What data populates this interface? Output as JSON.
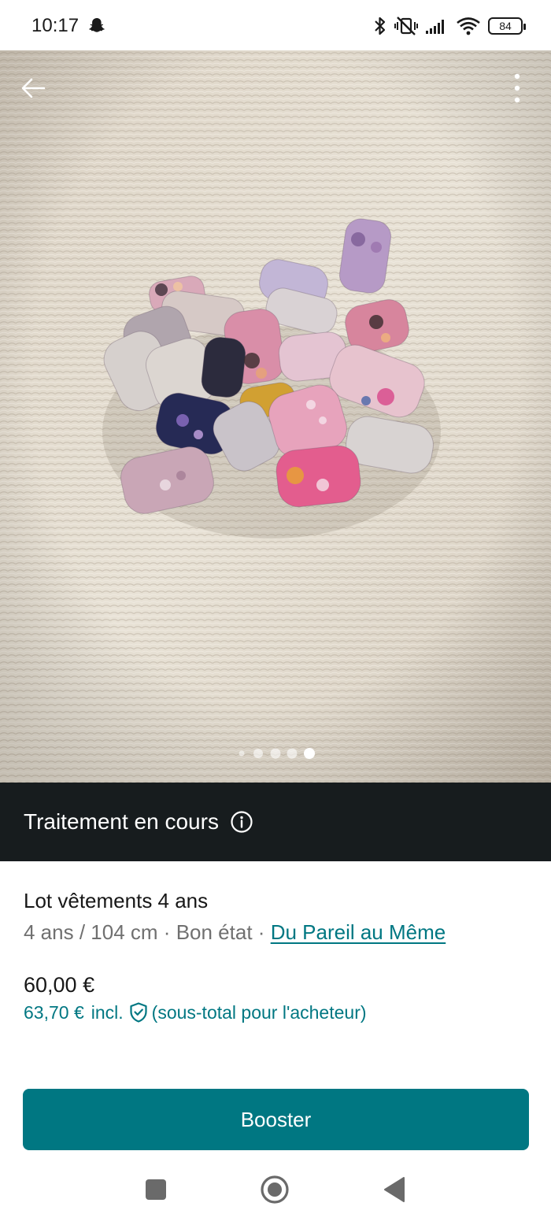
{
  "status_bar": {
    "time": "10:17",
    "battery": "84",
    "icons": [
      "snapchat-icon",
      "bluetooth-icon",
      "vibrate-mute-icon",
      "signal-icon",
      "wifi-icon",
      "battery-icon"
    ]
  },
  "photo": {
    "page_count": 5,
    "active_page": 5,
    "icons": [
      "back-arrow-icon",
      "more-vertical-icon"
    ]
  },
  "processing": {
    "label": "Traitement en cours",
    "icon": "info-icon"
  },
  "item": {
    "title": "Lot vêtements 4 ans",
    "size": "4 ans / 104 cm",
    "separator": "·",
    "condition": "Bon état",
    "brand": "Du Pareil au Même",
    "price": "60,00 €",
    "buyer_price": "63,70 €",
    "buyer_price_incl": "incl.",
    "buyer_note": "(sous-total pour l'acheteur)"
  },
  "actions": {
    "booster_label": "Booster"
  },
  "colors": {
    "brand": "#007782",
    "dark_bar": "#171c1e"
  },
  "nav": [
    "recents-square-icon",
    "home-circle-icon",
    "back-triangle-icon"
  ]
}
